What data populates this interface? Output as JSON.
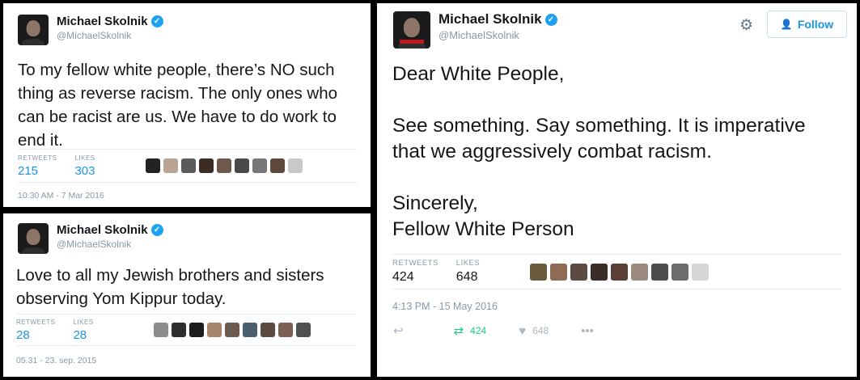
{
  "tweets": [
    {
      "name": "Michael Skolnik",
      "handle": "@MichaelSkolnik",
      "text": "To my fellow white people, there’s NO such\nthing as reverse racism. The only ones who\ncan be racist are us. We have to do work to\nend it.",
      "retweets_label": "RETWEETS",
      "retweets": "215",
      "likes_label": "LIKES",
      "likes": "303",
      "timestamp": "10:30 AM - 7 Mar 2016"
    },
    {
      "name": "Michael Skolnik",
      "handle": "@MichaelSkolnik",
      "text": "Love to all my Jewish brothers and sisters\nobserving Yom Kippur today.",
      "retweets_label": "RETWEETS",
      "retweets": "28",
      "likes_label": "LIKES",
      "likes": "28",
      "timestamp": "05.31 - 23. sep. 2015"
    },
    {
      "name": "Michael Skolnik",
      "handle": "@MichaelSkolnik",
      "follow_label": "Follow",
      "text": "Dear White People,\n\nSee something. Say something. It is imperative\nthat we aggressively combat racism.\n\nSincerely,\nFellow White Person",
      "retweets_label": "RETWEETS",
      "retweets": "424",
      "likes_label": "LIKES",
      "likes": "648",
      "timestamp": "4:13 PM - 15 May 2016",
      "action_retweets": "424",
      "action_likes": "648"
    }
  ],
  "icons": {
    "verified": "verified-badge-icon",
    "gear": "gear-icon",
    "follow": "add-user-icon",
    "reply": "reply-icon",
    "retweet": "retweet-icon",
    "like": "heart-icon",
    "more": "more-icon"
  },
  "colors": {
    "link_blue": "#1b95e0",
    "verified_blue": "#1da1f2",
    "retweet_green": "#19cf86",
    "muted_gray": "#8899a6"
  },
  "mini_avatar_colors": {
    "a": [
      "#222222",
      "#b9a393",
      "#5b5b5b",
      "#3b2c24",
      "#6e5a4d",
      "#4a4a4a",
      "#777777",
      "#5e4a3c",
      "#c9c9c9"
    ],
    "b": [
      "#8c8c8c",
      "#2d2d2d",
      "#1c1c1c",
      "#a8856b",
      "#6a5a50",
      "#4a5d6b",
      "#5a4a40",
      "#7d5f50",
      "#505050"
    ],
    "c": [
      "#6b5b3d",
      "#8f6a55",
      "#5d4a42",
      "#3a2d28",
      "#5a3f36",
      "#9c8a80",
      "#4d4d4d",
      "#6d6d6d",
      "#d6d6d6"
    ]
  }
}
